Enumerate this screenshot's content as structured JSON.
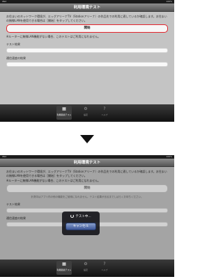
{
  "screen": {
    "status_left": "iPad",
    "status_right": "100%",
    "title": "利用環境テスト",
    "notice": "お住まいのネットワーク環境が、エッグアリーナTV（Stationアリーナ）の作品先での利用に適しているか確認します。お住まいの無線LANを使用できる場合は［開始］をタップしてください。",
    "warning": "※ルーターに無線LAN機能がない場合、このテストはご利用になれません。",
    "start_label": "開始",
    "running_hint": "計測中はアプリ内の他の機能をご使用になれません。テスト結果が出るまでしばらくお待ちください。",
    "test_result_label": "テスト結果",
    "speed_label": "通信速度の結果",
    "tabs": [
      {
        "icon": "▦",
        "label": "利用環境テスト"
      },
      {
        "icon": "⚙",
        "label": "設定"
      },
      {
        "icon": "?",
        "label": "ヘルプ"
      }
    ],
    "hud_text": "テスト中...",
    "cancel_label": "キャンセル"
  },
  "colors": {
    "accent": "#e4232b",
    "nav_bar": "#6a6a6a",
    "content_bg": "#c4c4c4",
    "cancel_button": "#3c5698"
  }
}
